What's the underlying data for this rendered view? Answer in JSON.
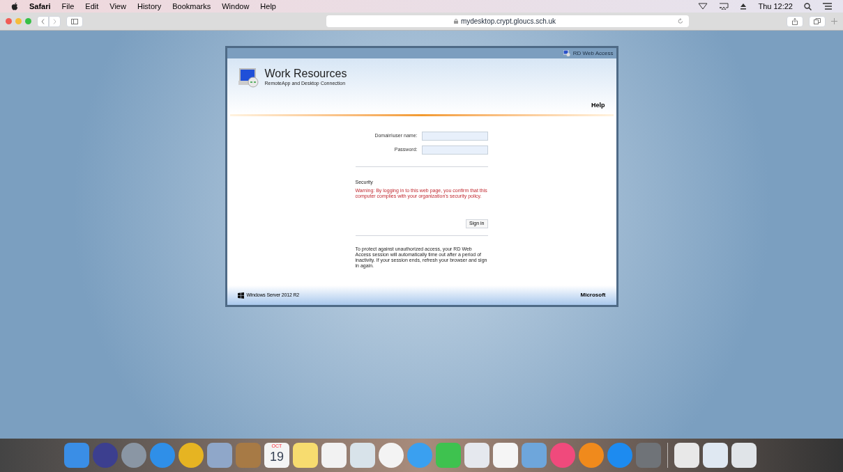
{
  "menu_bar": {
    "app": "Safari",
    "items": [
      "File",
      "Edit",
      "View",
      "History",
      "Bookmarks",
      "Window",
      "Help"
    ],
    "clock": "Thu 12:22"
  },
  "toolbar": {
    "address": "mydesktop.crypt.gloucs.sch.uk"
  },
  "page": {
    "top_link": "RD Web Access",
    "title": "Work Resources",
    "subtitle": "RemoteApp and Desktop Connection",
    "help": "Help",
    "fields": [
      {
        "label": "Domain\\user name:"
      },
      {
        "label": "Password:"
      }
    ],
    "security_heading": "Security",
    "warning": "Warning: By logging in to this web page, you confirm that this computer complies with your organization's security policy.",
    "sign_in": "Sign in",
    "note": "To protect against unauthorized access, your RD Web Access session will automatically time out after a period of inactivity. If your session ends, refresh your browser and sign in again.",
    "footer_left": "Windows Server 2012 R2",
    "footer_right": "Microsoft"
  },
  "dock": [
    {
      "kind": "square",
      "color": "#3a8ee6"
    },
    {
      "kind": "circle",
      "color": "#3c3f8f"
    },
    {
      "kind": "circle",
      "color": "#8a96a4"
    },
    {
      "kind": "circle",
      "color": "#2f8fe8"
    },
    {
      "kind": "circle",
      "color": "#e6b422"
    },
    {
      "kind": "square",
      "color": "#8fa7c9"
    },
    {
      "kind": "square",
      "color": "#a77a45"
    },
    {
      "kind": "calendar",
      "color": "#f4f4f4",
      "month": "OCT",
      "day": "19"
    },
    {
      "kind": "square",
      "color": "#f7dc6f"
    },
    {
      "kind": "square",
      "color": "#f2f2f2"
    },
    {
      "kind": "square",
      "color": "#d8e3ea"
    },
    {
      "kind": "circle",
      "color": "#f3f3f3"
    },
    {
      "kind": "circle",
      "color": "#3aa0f0"
    },
    {
      "kind": "square",
      "color": "#3ec24f"
    },
    {
      "kind": "square",
      "color": "#e5e8ee"
    },
    {
      "kind": "square",
      "color": "#f5f5f5"
    },
    {
      "kind": "square",
      "color": "#6ea6db"
    },
    {
      "kind": "circle",
      "color": "#f04a7c"
    },
    {
      "kind": "circle",
      "color": "#f08a1c"
    },
    {
      "kind": "circle",
      "color": "#1d8bf0"
    },
    {
      "kind": "square",
      "color": "#6f7378"
    },
    {
      "kind": "divider"
    },
    {
      "kind": "square",
      "color": "#e8e8e8"
    },
    {
      "kind": "square",
      "color": "#dfe8f2"
    },
    {
      "kind": "square",
      "color": "#e0e4e8"
    }
  ]
}
